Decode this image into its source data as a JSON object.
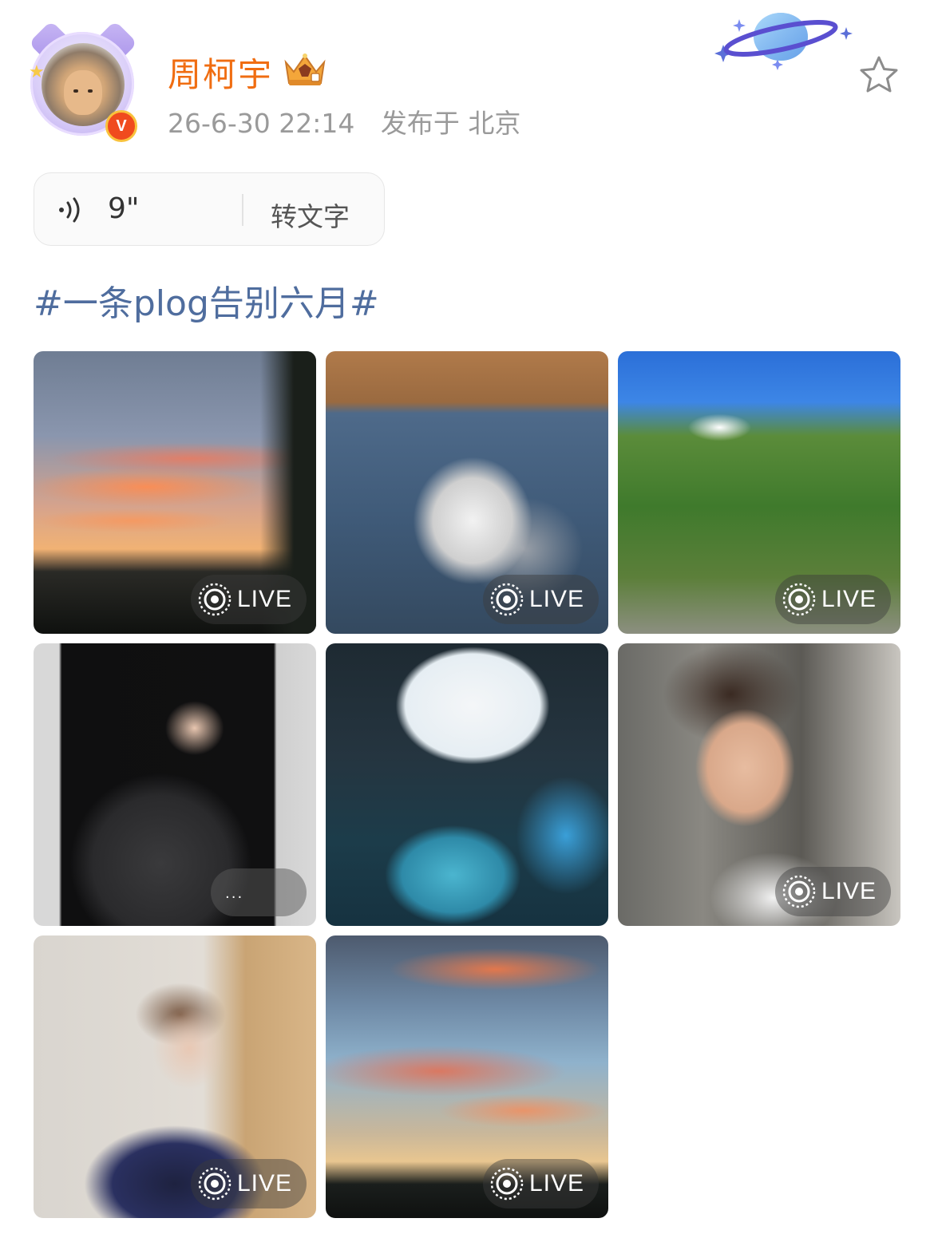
{
  "post": {
    "author_name": "周柯宇",
    "timestamp": "26-6-30 22:14",
    "location": "发布于 北京"
  },
  "voice": {
    "duration": "9\"",
    "transcribe_label": "转文字"
  },
  "topic": "#一条plog告别六月#",
  "photos": [
    {
      "description": "sunset sky with pink clouds",
      "badge": "LIVE"
    },
    {
      "description": "grey white kitten in denim bag",
      "badge": "LIVE"
    },
    {
      "description": "green mountain under blue sky",
      "badge": "LIVE"
    },
    {
      "description": "young man in black jacket waving",
      "badge": ""
    },
    {
      "description": "magazine cover with blue flowers and doll",
      "badge": ""
    },
    {
      "description": "young man in white tank top",
      "badge": "LIVE"
    },
    {
      "description": "young man with brown hair, blue turtleneck",
      "badge": "LIVE"
    },
    {
      "description": "orange clouds at dusk",
      "badge": "LIVE"
    }
  ],
  "colors": {
    "author_name": "#f06d11",
    "topic": "#4f6d9e",
    "meta": "#9a9a9a",
    "v_badge": "#f04b1e"
  },
  "icons": [
    "v-badge-icon",
    "crown-icon",
    "planet-icon",
    "favorite-star-icon",
    "voice-wave-icon",
    "live-photo-icon"
  ]
}
